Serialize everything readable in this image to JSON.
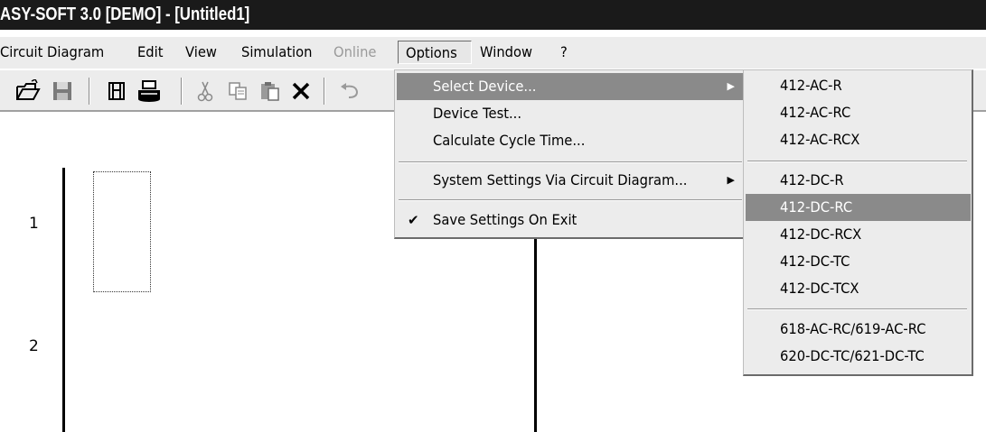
{
  "window": {
    "title": "ASY-SOFT 3.0 [DEMO] - [Untitled1]"
  },
  "menubar": {
    "items": [
      {
        "label": "Circuit Diagram",
        "state": "normal"
      },
      {
        "label": "Edit",
        "state": "normal"
      },
      {
        "label": "View",
        "state": "normal"
      },
      {
        "label": "Simulation",
        "state": "normal"
      },
      {
        "label": "Online",
        "state": "disabled"
      },
      {
        "label": "Options",
        "state": "open"
      },
      {
        "label": "Window",
        "state": "normal"
      },
      {
        "label": "?",
        "state": "normal"
      }
    ]
  },
  "toolbar": {
    "buttons": [
      {
        "icon": "open-folder-icon"
      },
      {
        "icon": "save-disk-icon"
      },
      {
        "icon": "print-preview-icon"
      },
      {
        "icon": "printer-icon"
      },
      {
        "icon": "cut-scissors-icon"
      },
      {
        "icon": "copy-icon"
      },
      {
        "icon": "paste-icon"
      },
      {
        "icon": "delete-x-icon"
      },
      {
        "icon": "undo-icon"
      }
    ]
  },
  "canvas": {
    "rows": [
      "1",
      "2"
    ]
  },
  "options_menu": {
    "items": [
      {
        "label": "Select Device...",
        "has_submenu": true,
        "highlighted": true
      },
      {
        "label": "Device Test...",
        "has_submenu": false
      },
      {
        "label": "Calculate Cycle Time...",
        "has_submenu": false
      },
      {
        "label": "System Settings Via Circuit Diagram...",
        "has_submenu": true
      },
      {
        "label": "Save Settings On Exit",
        "checked": true
      }
    ]
  },
  "device_submenu": {
    "items": [
      "412-AC-R",
      "412-AC-RC",
      "412-AC-RCX",
      "412-DC-R",
      "412-DC-RC",
      "412-DC-RCX",
      "412-DC-TC",
      "412-DC-TCX",
      "618-AC-RC/619-AC-RC",
      "620-DC-TC/621-DC-TC"
    ],
    "highlighted": "412-DC-RC"
  },
  "colors": {
    "titlebar_bg": "#1a1a1a",
    "menu_bg": "#ececec",
    "highlight_bg": "#8a8a8a",
    "disabled_text": "#9a9a9a"
  }
}
